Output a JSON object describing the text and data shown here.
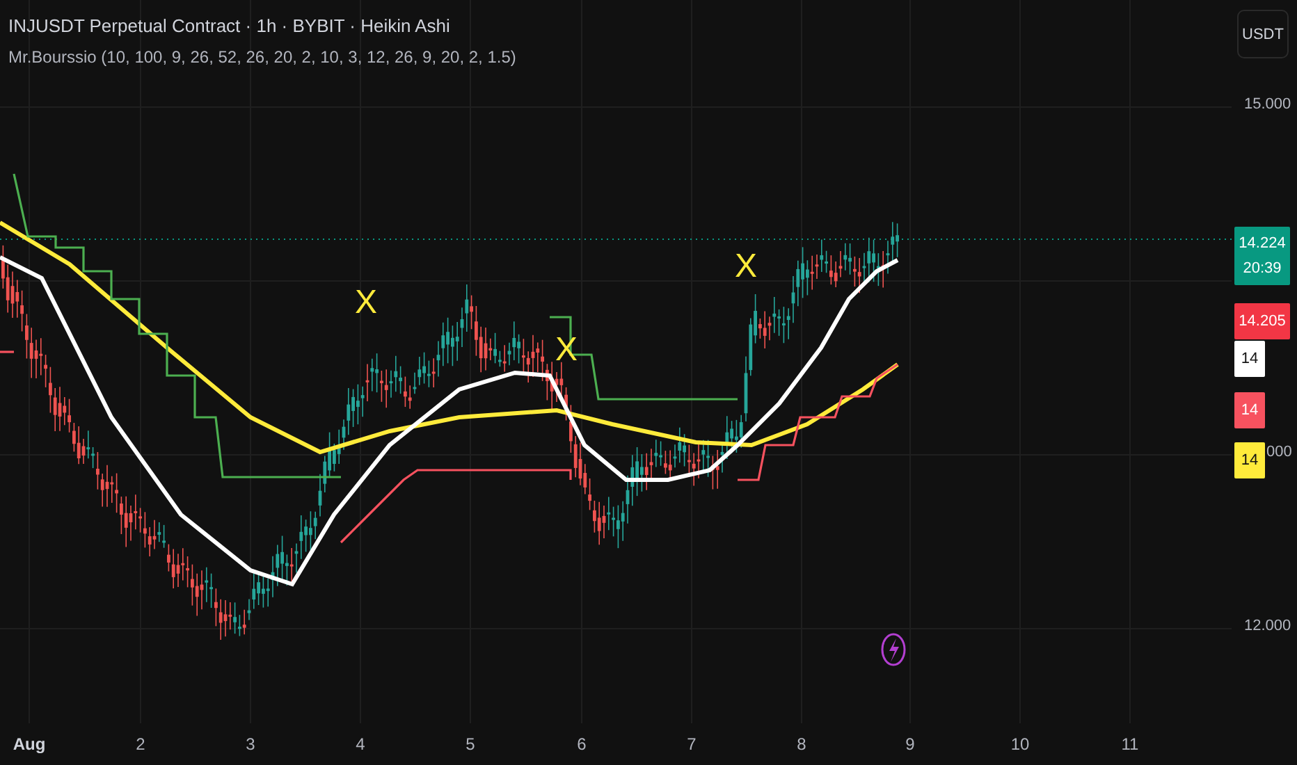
{
  "header": {
    "title": "INJUSDT Perpetual Contract · 1h · BYBIT · Heikin Ashi",
    "indicator": "Mr.Bourssio (10, 100, 9, 26, 52, 26, 20, 2, 10, 3, 12, 26, 9, 20, 2, 1.5)"
  },
  "currency_button": "USDT",
  "price_axis": {
    "labels": [
      "15.000",
      "000",
      "12.000"
    ]
  },
  "price_tags": [
    {
      "lines": [
        "14.224",
        "20:39"
      ],
      "color": "#089981"
    },
    {
      "lines": [
        "14.205"
      ],
      "color": "#f23645"
    },
    {
      "lines": [
        "14"
      ],
      "color": "#ffffff"
    },
    {
      "lines": [
        "14"
      ],
      "color": "#f7525f"
    },
    {
      "lines": [
        "14"
      ],
      "color": "#ffeb3b"
    }
  ],
  "time_axis": {
    "labels": [
      {
        "text": "Aug",
        "kind": "month"
      },
      {
        "text": "2",
        "kind": "day"
      },
      {
        "text": "3",
        "kind": "day"
      },
      {
        "text": "4",
        "kind": "day"
      },
      {
        "text": "5",
        "kind": "day"
      },
      {
        "text": "6",
        "kind": "day"
      },
      {
        "text": "7",
        "kind": "day"
      },
      {
        "text": "8",
        "kind": "day"
      },
      {
        "text": "9",
        "kind": "day"
      },
      {
        "text": "10",
        "kind": "day"
      },
      {
        "text": "11",
        "kind": "day"
      }
    ]
  },
  "signals": [
    "X",
    "X",
    "X"
  ]
}
